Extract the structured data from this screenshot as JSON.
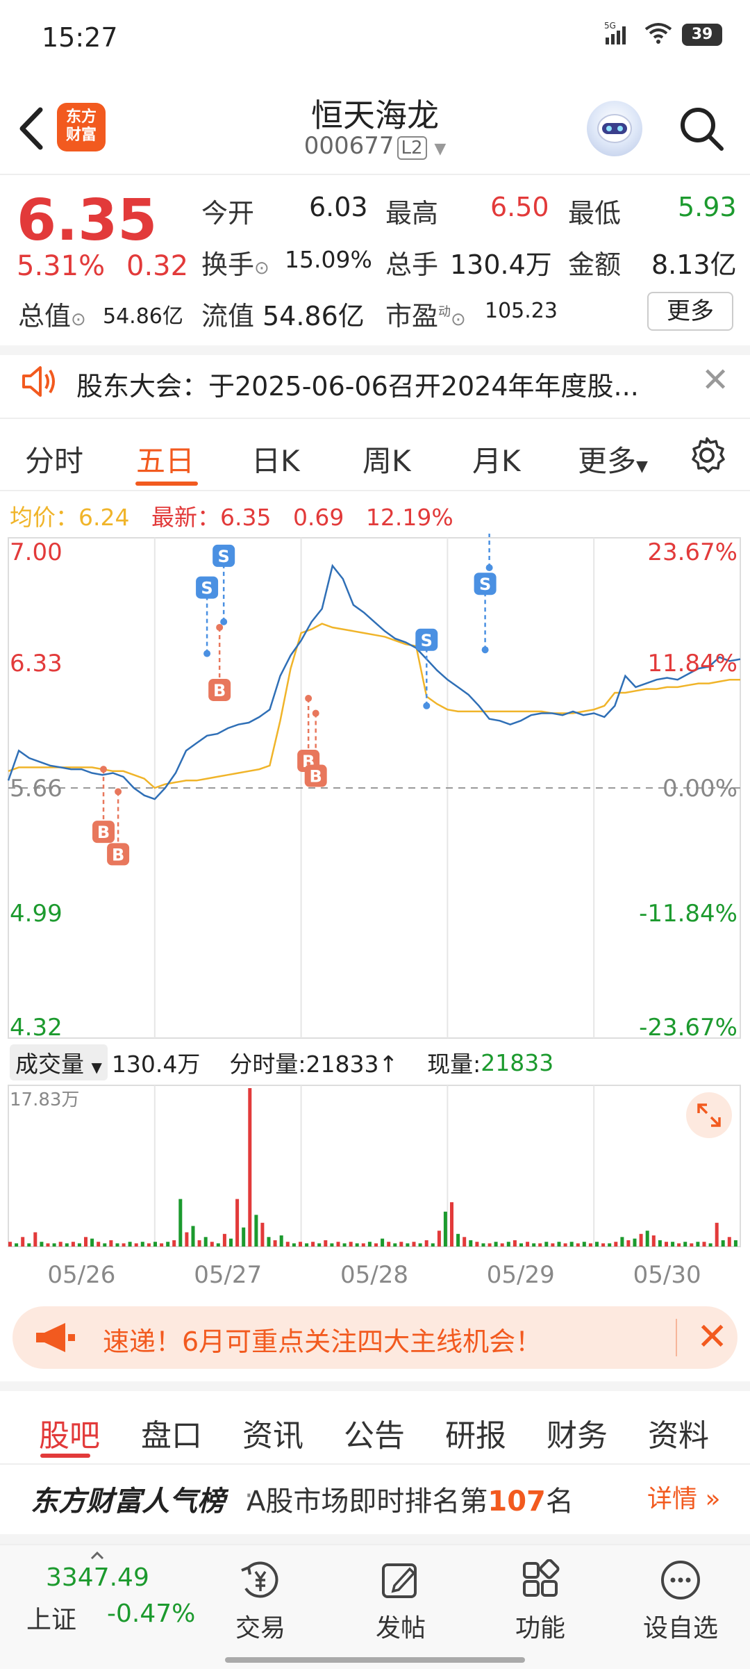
{
  "status_bar": {
    "time": "15:27",
    "network": "5G",
    "battery": "39"
  },
  "header": {
    "back_icon": "chevron-left-icon",
    "logo_text": "东方\n财富",
    "stock_name": "恒天海龙",
    "stock_code": "000677",
    "level_badge": "L2",
    "search_icon": "search-icon"
  },
  "quote": {
    "price": "6.35",
    "change_pct": "5.31%",
    "change_abs": "0.32",
    "open_label": "今开",
    "open": "6.03",
    "high_label": "最高",
    "high": "6.50",
    "low_label": "最低",
    "low": "5.93",
    "turnover_label": "换手",
    "turnover": "15.09%",
    "volume_label": "总手",
    "volume": "130.4万",
    "amount_label": "金额",
    "amount": "8.13亿",
    "mktcap_label": "总值",
    "mktcap": "54.86亿",
    "float_label": "流值",
    "float_cap": "54.86亿",
    "pe_label": "市盈",
    "pe_sup": "动",
    "pe": "105.23",
    "more_label": "更多"
  },
  "notice": {
    "text": "股东大会：于2025-06-06召开2024年年度股..."
  },
  "chart_tabs": {
    "items": [
      "分时",
      "五日",
      "日K",
      "周K",
      "月K",
      "更多"
    ],
    "active": "五日"
  },
  "info_line": {
    "avg_label": "均价：",
    "avg": "6.24",
    "latest_label": "最新：",
    "latest": "6.35",
    "chg": "0.69",
    "chg_pct": "12.19%"
  },
  "chart_data": {
    "type": "line",
    "x": [
      "05/26",
      "05/27",
      "05/28",
      "05/29",
      "05/30"
    ],
    "ylim": [
      4.32,
      7.0
    ],
    "y_ticks_left": [
      "7.00",
      "6.33",
      "5.66",
      "4.99",
      "4.32"
    ],
    "y_ticks_right": [
      "23.67%",
      "11.84%",
      "0.00%",
      "-11.84%",
      "-23.67%"
    ],
    "series": [
      {
        "values": [
          5.7,
          5.86,
          5.82,
          5.8,
          5.78,
          5.77,
          5.76,
          5.76,
          5.74,
          5.73,
          5.74,
          5.72,
          5.66,
          5.62,
          5.6,
          5.66,
          5.74,
          5.86,
          5.9,
          5.94,
          5.95,
          5.98,
          6.0,
          6.01,
          6.04,
          6.08,
          6.26,
          6.37,
          6.45,
          6.55,
          6.62,
          6.85,
          6.78,
          6.64,
          6.6,
          6.55,
          6.5,
          6.46,
          6.44,
          6.41,
          6.35,
          6.29,
          6.24,
          6.2,
          6.16,
          6.1,
          6.03,
          6.02,
          6.0,
          6.02,
          6.05,
          6.06,
          6.06,
          6.05,
          6.07,
          6.05,
          6.06,
          6.04,
          6.1,
          6.26,
          6.2,
          6.22,
          6.24,
          6.25,
          6.24,
          6.27,
          6.3,
          6.31,
          6.36,
          6.34,
          6.35
        ]
      },
      {
        "values": [
          5.75,
          5.77,
          5.77,
          5.77,
          5.77,
          5.77,
          5.77,
          5.77,
          5.77,
          5.76,
          5.75,
          5.75,
          5.73,
          5.71,
          5.66,
          5.68,
          5.69,
          5.7,
          5.7,
          5.71,
          5.72,
          5.73,
          5.74,
          5.75,
          5.76,
          5.78,
          6.02,
          6.3,
          6.49,
          6.51,
          6.54,
          6.52,
          6.51,
          6.5,
          6.49,
          6.48,
          6.47,
          6.45,
          6.43,
          6.42,
          6.15,
          6.11,
          6.08,
          6.07,
          6.07,
          6.07,
          6.07,
          6.07,
          6.07,
          6.07,
          6.07,
          6.07,
          6.06,
          6.06,
          6.06,
          6.07,
          6.08,
          6.1,
          6.17,
          6.17,
          6.18,
          6.19,
          6.19,
          6.2,
          6.2,
          6.21,
          6.22,
          6.22,
          6.23,
          6.24,
          6.24
        ]
      }
    ],
    "markers": [
      {
        "label": "B",
        "x": 9.1,
        "y": 5.76
      },
      {
        "label": "B",
        "x": 10.5,
        "y": 5.64
      },
      {
        "label": "S",
        "x": 19.0,
        "y": 6.38
      },
      {
        "label": "B",
        "x": 20.2,
        "y": 6.52
      },
      {
        "label": "S",
        "x": 20.6,
        "y": 6.55
      },
      {
        "label": "B",
        "x": 28.7,
        "y": 6.14
      },
      {
        "label": "B",
        "x": 29.4,
        "y": 6.06
      },
      {
        "label": "S",
        "x": 40.0,
        "y": 6.1
      },
      {
        "label": "S",
        "x": 45.6,
        "y": 6.4
      },
      {
        "label": "S",
        "x": 46.0,
        "y": 6.84
      }
    ],
    "colors": {
      "price": "#2f6fb6",
      "avg": "#f0b429",
      "buy": "#e8775c",
      "sell": "#4a90e2"
    }
  },
  "volume": {
    "selector_label": "成交量",
    "total": "130.4万",
    "tick_label": "分时量:21833↑",
    "current_label": "现量:",
    "current": "21833",
    "max_label": "17.83万",
    "expand_icon": "expand-icon",
    "bars": [
      3,
      2,
      6,
      2,
      9,
      3,
      2,
      2,
      3,
      2,
      3,
      2,
      6,
      5,
      3,
      2,
      4,
      2,
      2,
      3,
      2,
      3,
      2,
      3,
      2,
      3,
      4,
      30,
      9,
      13,
      4,
      6,
      3,
      2,
      8,
      5,
      30,
      12,
      100,
      20,
      15,
      6,
      4,
      7,
      3,
      2,
      3,
      2,
      3,
      2,
      4,
      2,
      3,
      2,
      3,
      2,
      2,
      3,
      2,
      5,
      3,
      2,
      3,
      2,
      3,
      2,
      4,
      2,
      10,
      22,
      28,
      8,
      6,
      4,
      3,
      2,
      2,
      3,
      2,
      3,
      4,
      2,
      3,
      2,
      2,
      3,
      2,
      3,
      2,
      3,
      2,
      3,
      2,
      3,
      2,
      2,
      3,
      6,
      4,
      5,
      8,
      10,
      7,
      4,
      3,
      3,
      2,
      3,
      2,
      3,
      3,
      2,
      15,
      4,
      6,
      4
    ]
  },
  "banner": {
    "icon": "megaphone-icon",
    "text": "速递！6月可重点关注四大主线机会！"
  },
  "bottom_tabs": {
    "items": [
      "股吧",
      "盘口",
      "资讯",
      "公告",
      "研报",
      "财务",
      "资料"
    ],
    "active": "股吧"
  },
  "ranking": {
    "brand": "东方财富人气榜",
    "desc_prefix": "A股市场即时排名第",
    "rank": "107",
    "desc_suffix": "名",
    "detail": "详情"
  },
  "bottom_nav": {
    "index_value": "3347.49",
    "index_name": "上证",
    "index_chg": "-0.47%",
    "items": [
      {
        "label": "交易",
        "icon": "trade-icon"
      },
      {
        "label": "发帖",
        "icon": "edit-icon"
      },
      {
        "label": "功能",
        "icon": "grid-icon"
      },
      {
        "label": "设自选",
        "icon": "more-icon"
      }
    ]
  }
}
